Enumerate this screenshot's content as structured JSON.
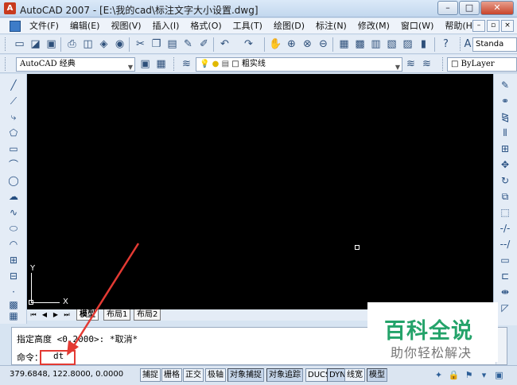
{
  "window": {
    "title": "AutoCAD 2007 - [E:\\我的cad\\标注文字大小设置.dwg]",
    "min": "–",
    "max": "□",
    "close": "✕"
  },
  "menu": {
    "items": [
      "文件(F)",
      "编辑(E)",
      "视图(V)",
      "插入(I)",
      "格式(O)",
      "工具(T)",
      "绘图(D)",
      "标注(N)",
      "修改(M)",
      "窗口(W)",
      "帮助(H)"
    ],
    "mdi": [
      "–",
      "▫",
      "×"
    ]
  },
  "toolbar1": {
    "text_style": "Standa"
  },
  "toolbar2": {
    "workspace": "AutoCAD 经典",
    "layer": "粗实线",
    "color": "ByLayer"
  },
  "canvas": {
    "ucs_y": "Y",
    "ucs_x": "X"
  },
  "tabs": {
    "items": [
      "模型",
      "布局1",
      "布局2"
    ]
  },
  "command": {
    "line1": "指定高度 <0.2000>: *取消*",
    "prompt": "命令：",
    "input": "dt"
  },
  "watermark": {
    "title": "百科全说",
    "subtitle": "助你轻松解决"
  },
  "status": {
    "coords": "379.6848, 122.8000, 0.0000",
    "buttons": [
      "捕捉",
      "栅格",
      "正交",
      "极轴",
      "对象捕捉",
      "对象追踪",
      "DUCS",
      "DYN",
      "线宽",
      "模型"
    ]
  },
  "colors": {
    "annotation": "#e33a33",
    "watermark": "#24a36a",
    "canvas": "#000000"
  }
}
